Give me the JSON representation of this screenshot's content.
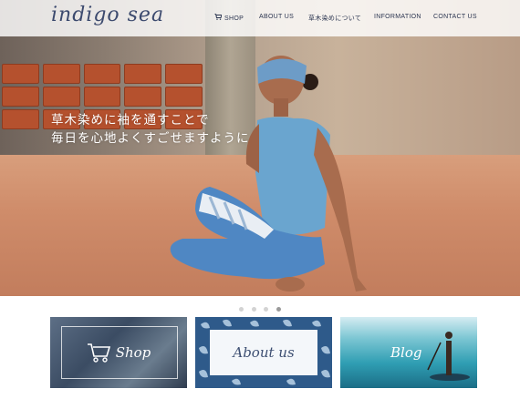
{
  "header": {
    "logo": "indigo sea",
    "nav": [
      {
        "label": "SHOP",
        "icon": "cart-icon"
      },
      {
        "label": "ABOUT US"
      },
      {
        "label": "草木染めについて"
      },
      {
        "label": "INFORMATION"
      },
      {
        "label": "CONTACT US"
      }
    ]
  },
  "hero": {
    "tagline_line1": "草木染めに袖を通すことで",
    "tagline_line2": "毎日を心地よくすごせますように"
  },
  "slider": {
    "count": 4,
    "active_index": 3
  },
  "cards": [
    {
      "label": "Shop",
      "icon": "cart-icon"
    },
    {
      "label": "About us"
    },
    {
      "label": "Blog"
    }
  ],
  "colors": {
    "brand": "#3c4a6e",
    "indigo": "#2e5a8a",
    "white": "#ffffff"
  }
}
